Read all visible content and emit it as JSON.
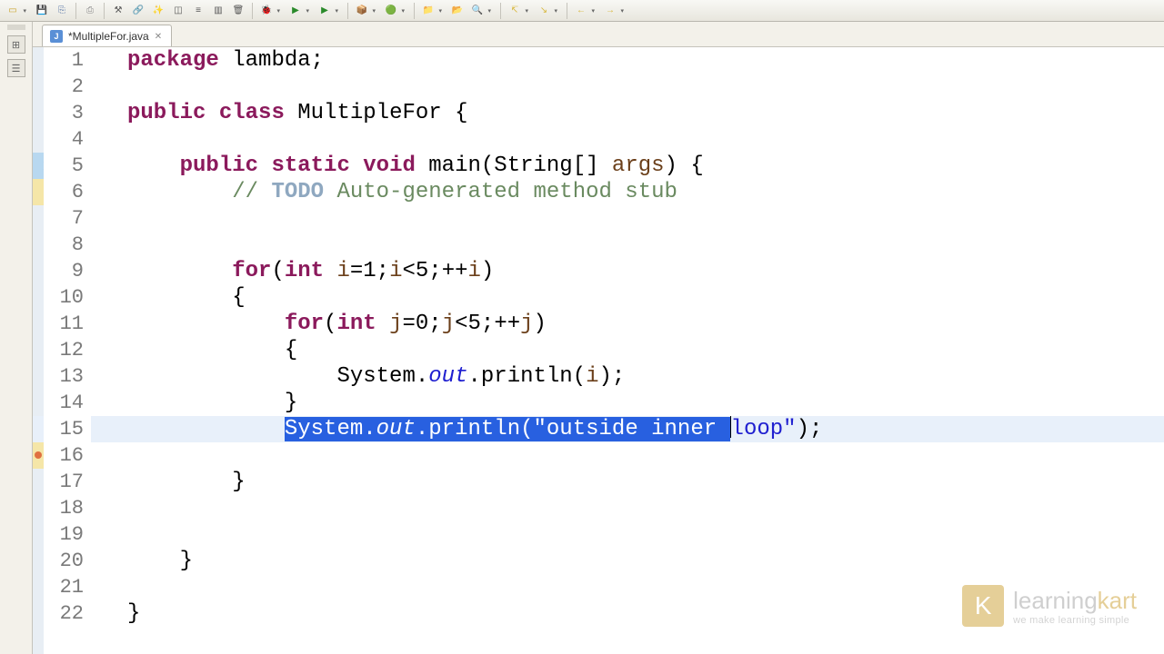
{
  "toolbar": {
    "buttons": [
      "new",
      "save",
      "save-all",
      "print",
      "sep",
      "build",
      "debug-drop",
      "skip",
      "toggle",
      "organize",
      "task",
      "trash",
      "sep",
      "config-drop",
      "run-drop",
      "run-last-drop",
      "sep",
      "package-drop",
      "refresh-drop",
      "sep",
      "open-type-drop",
      "open-drop",
      "search-drop",
      "sep",
      "prev-ann-drop",
      "next-ann-drop",
      "sep",
      "back-drop",
      "fwd-drop"
    ]
  },
  "tab": {
    "filename": "*MultipleFor.java"
  },
  "code": {
    "l1_a": "package",
    "l1_b": " lambda;",
    "l3_a": "public",
    "l3_b": " ",
    "l3_c": "class",
    "l3_d": " MultipleFor {",
    "l5_a": "    ",
    "l5_b": "public",
    "l5_c": " ",
    "l5_d": "static",
    "l5_e": " ",
    "l5_f": "void",
    "l5_g": " main(String[] ",
    "l5_h": "args",
    "l5_i": ") {",
    "l6_a": "        ",
    "l6_b": "// ",
    "l6_c": "TODO",
    "l6_d": " Auto-generated method stub",
    "l9_a": "        ",
    "l9_b": "for",
    "l9_c": "(",
    "l9_d": "int",
    "l9_e": " ",
    "l9_f": "i",
    "l9_g": "=1;",
    "l9_h": "i",
    "l9_i": "<5;++",
    "l9_j": "i",
    "l9_k": ")",
    "l10": "        {",
    "l11_a": "            ",
    "l11_b": "for",
    "l11_c": "(",
    "l11_d": "int",
    "l11_e": " ",
    "l11_f": "j",
    "l11_g": "=0;",
    "l11_h": "j",
    "l11_i": "<5;++",
    "l11_j": "j",
    "l11_k": ")",
    "l12": "            {",
    "l13_a": "                System.",
    "l13_b": "out",
    "l13_c": ".println(",
    "l13_d": "i",
    "l13_e": ");",
    "l14": "            }",
    "l15_sel_a": "System.",
    "l15_sel_b": "out",
    "l15_sel_c": ".println(",
    "l15_sel_d": "\"outside inner ",
    "l15_after_a": "loop\"",
    "l15_after_b": ");",
    "l15_indent": "            ",
    "l17": "        }",
    "l20": "    }",
    "l22": "}"
  },
  "linecount": 22,
  "watermark": {
    "brand_a": "learning",
    "brand_b": "kart",
    "tag": "we make learning simple"
  }
}
